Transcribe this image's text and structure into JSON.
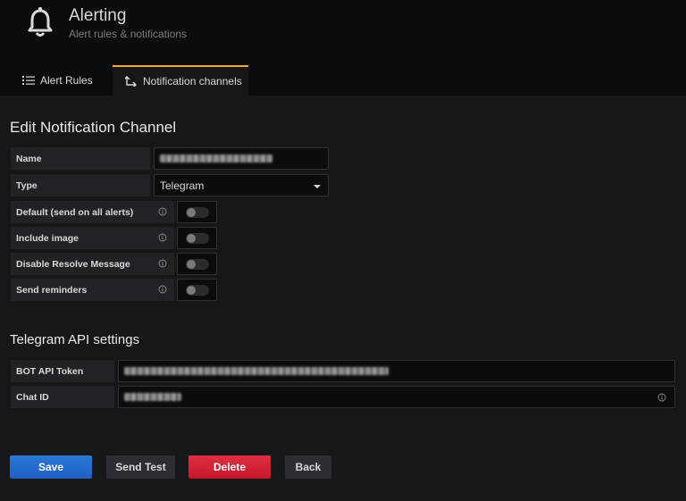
{
  "header": {
    "title": "Alerting",
    "subtitle": "Alert rules & notifications",
    "icon": "bell-icon"
  },
  "tabs": [
    {
      "label": "Alert Rules",
      "icon": "list-icon",
      "active": false
    },
    {
      "label": "Notification channels",
      "icon": "channel-icon",
      "active": true,
      "accent": "#f5a623"
    }
  ],
  "form": {
    "title": "Edit Notification Channel",
    "name": {
      "label": "Name",
      "value_redacted": true
    },
    "type": {
      "label": "Type",
      "value": "Telegram"
    },
    "toggles": [
      {
        "label": "Default (send on all alerts)",
        "checked": false
      },
      {
        "label": "Include image",
        "checked": false
      },
      {
        "label": "Disable Resolve Message",
        "checked": false
      },
      {
        "label": "Send reminders",
        "checked": false
      }
    ]
  },
  "telegram": {
    "title": "Telegram API settings",
    "bot_token": {
      "label": "BOT API Token",
      "value_redacted": true
    },
    "chat_id": {
      "label": "Chat ID",
      "value_redacted": true
    }
  },
  "buttons": {
    "save": "Save",
    "send_test": "Send Test",
    "delete": "Delete",
    "back": "Back"
  },
  "colors": {
    "primary": "#1f60c4",
    "danger": "#c4162a",
    "tab_accent": "#f5a623"
  }
}
